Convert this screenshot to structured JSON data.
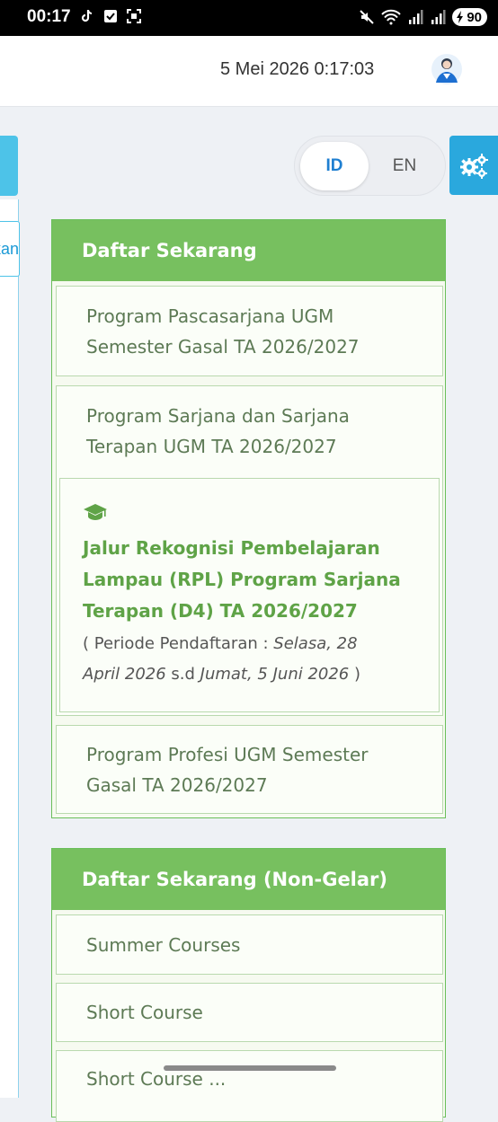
{
  "status_bar": {
    "time": "00:17",
    "battery": "90"
  },
  "header": {
    "datetime": "5 Mei 2026 0:17:03"
  },
  "left_panel": {
    "label": "pikan"
  },
  "language": {
    "options": [
      "ID",
      "EN"
    ],
    "selected": "ID"
  },
  "card1": {
    "title": "Daftar Sekarang",
    "items": [
      {
        "line1": "Program Pascasarjana UGM",
        "line2": "Semester Gasal TA 2026/2027"
      },
      {
        "line1": "Program Sarjana dan Sarjana",
        "line2": "Terapan UGM TA 2026/2027"
      },
      {
        "line1": "Program Profesi UGM Semester",
        "line2": "Gasal TA 2026/2027"
      }
    ],
    "sub_item": {
      "line1": "Jalur Rekognisi Pembelajaran",
      "line2": "Lampau (RPL) Program Sarjana",
      "line3": "Terapan (D4) TA 2026/2027",
      "period_prefix": "( Periode Pendaftaran : ",
      "start": "Selasa, 28",
      "start2": "April 2026",
      "between": " s.d ",
      "end": "Jumat, 5 Juni 2026",
      "suffix": " )"
    }
  },
  "card2": {
    "title": "Daftar Sekarang (Non-Gelar)",
    "items": [
      "Summer Courses",
      "Short Course",
      "Short Course ..."
    ]
  }
}
